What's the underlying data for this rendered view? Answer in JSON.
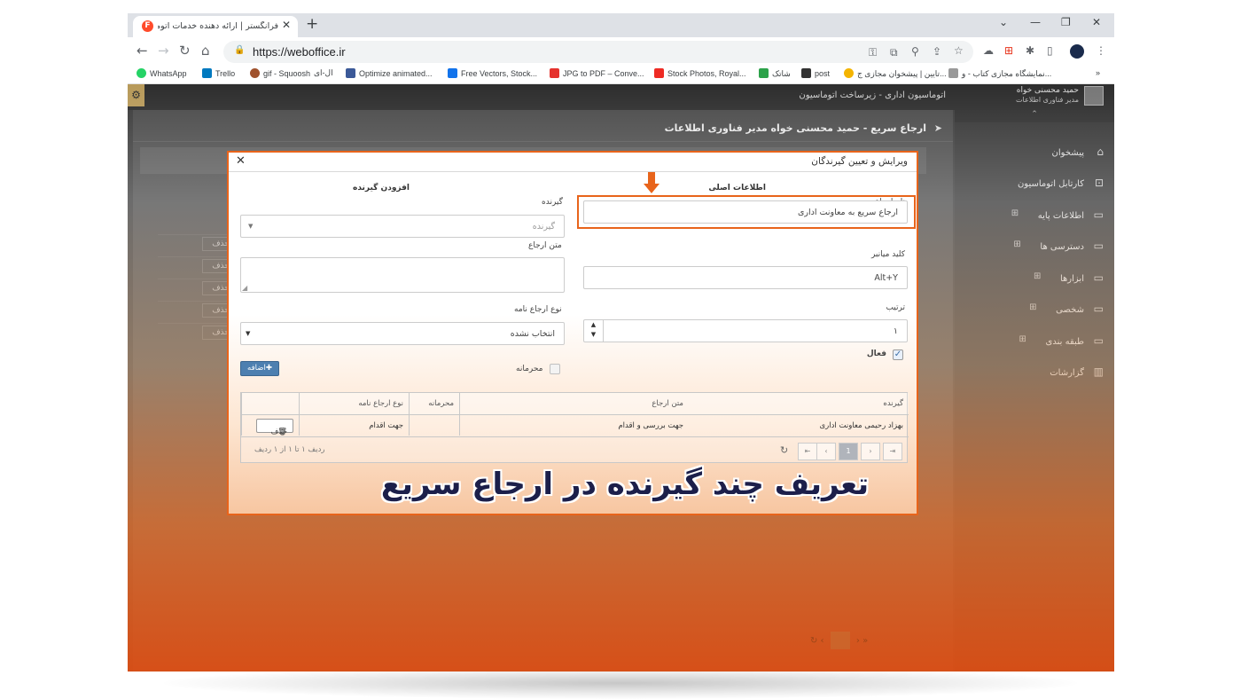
{
  "browser": {
    "tab_title": "فرانگستر | ارائه دهنده خدمات اتوماسیون اداری",
    "tab_favicon": "F",
    "url": "https://weboffice.ir",
    "bookmarks": [
      {
        "label": "WhatsApp",
        "icon": "whatsapp-icon",
        "color": "#25d366"
      },
      {
        "label": "Trello",
        "icon": "trello-icon",
        "color": "#0079bf"
      },
      {
        "label": "gif - Squoosh",
        "icon": "squoosh-icon",
        "color": "#a0522d"
      },
      {
        "label": "ال-ای",
        "icon": "page-icon",
        "color": "#777777"
      },
      {
        "label": "Optimize animated...",
        "icon": "ezgif-icon",
        "color": "#3b5998"
      },
      {
        "label": "Free Vectors, Stock...",
        "icon": "freepik-icon",
        "color": "#1273eb"
      },
      {
        "label": "JPG to PDF – Conve...",
        "icon": "ilovepdf-icon",
        "color": "#e5322d"
      },
      {
        "label": "Stock Photos, Royal...",
        "icon": "shutterstock-icon",
        "color": "#ee2b24"
      },
      {
        "label": "شاتک",
        "icon": "grid-icon",
        "color": "#2ca24a"
      },
      {
        "label": "post",
        "icon": "post-icon",
        "color": "#333333"
      },
      {
        "label": "تایین | پیشخوان مجازی ج...",
        "icon": "chrome-icon",
        "color": "#f4b400"
      },
      {
        "label": "نمایشگاه مجازی کتاب - و...",
        "icon": "book-icon",
        "color": "#999999"
      }
    ]
  },
  "app": {
    "breadcrumb": "اتوماسیون اداری - زیرساخت اتوماسیون",
    "user_name": "حمید محسنی خواه",
    "user_role": "مدیر فناوری اطلاعات",
    "page_title": "ارجاع سریع - حمید محسنی خواه مدیر فناوری اطلاعات",
    "sidebar": [
      {
        "label": "پیشخوان",
        "icon": "home-icon"
      },
      {
        "label": "کارتابل اتوماسیون",
        "icon": "inbox-icon"
      },
      {
        "label": "اطلاعات پایه",
        "icon": "folder-icon"
      },
      {
        "label": "دسترسی ها",
        "icon": "folder-icon"
      },
      {
        "label": "ابزارها",
        "icon": "folder-icon"
      },
      {
        "label": "شخصی",
        "icon": "folder-icon"
      },
      {
        "label": "طبقه بندی",
        "icon": "folder-icon"
      },
      {
        "label": "گزارشات",
        "icon": "chart-icon"
      }
    ],
    "bg_delete_label": "حذف"
  },
  "modal": {
    "title": "ویرایش و تعیین گیرندگان",
    "main_section": "اطلاعات اصلی",
    "recipient_section": "افزودن گیرنده",
    "name_label": "نام ارجاع",
    "name_value": "ارجاع سریع به معاونت اداری",
    "shortcut_label": "کلید میانبر",
    "shortcut_value": "Alt+Y",
    "order_label": "ترتیب",
    "order_value": "۱",
    "active_label": "فعال",
    "recipient_label": "گیرنده",
    "recipient_placeholder": "گیرنده",
    "text_label": "متن ارجاع",
    "letter_type_label": "نوع ارجاع نامه",
    "letter_type_value": "انتخاب نشده",
    "confidential_label": "محرمانه",
    "add_button": "اضافه",
    "grid": {
      "columns": [
        "گیرنده",
        "متن ارجاع",
        "محرمانه",
        "نوع ارجاع نامه"
      ],
      "row": {
        "recipient": "بهزاد رحیمی معاونت اداری",
        "text": "جهت بررسی و اقدام",
        "confidential": "",
        "letter_type": "جهت اقدام",
        "delete": "حذف"
      },
      "current_page": "1",
      "pager_info": "ردیف ۱ تا ۱ از ۱ ردیف"
    }
  },
  "caption": "تعریف چند گیرنده در ارجاع سریع",
  "colors": {
    "accent": "#e8641b",
    "caption": "#1c1f4a",
    "add_button": "#4d7fb0"
  }
}
